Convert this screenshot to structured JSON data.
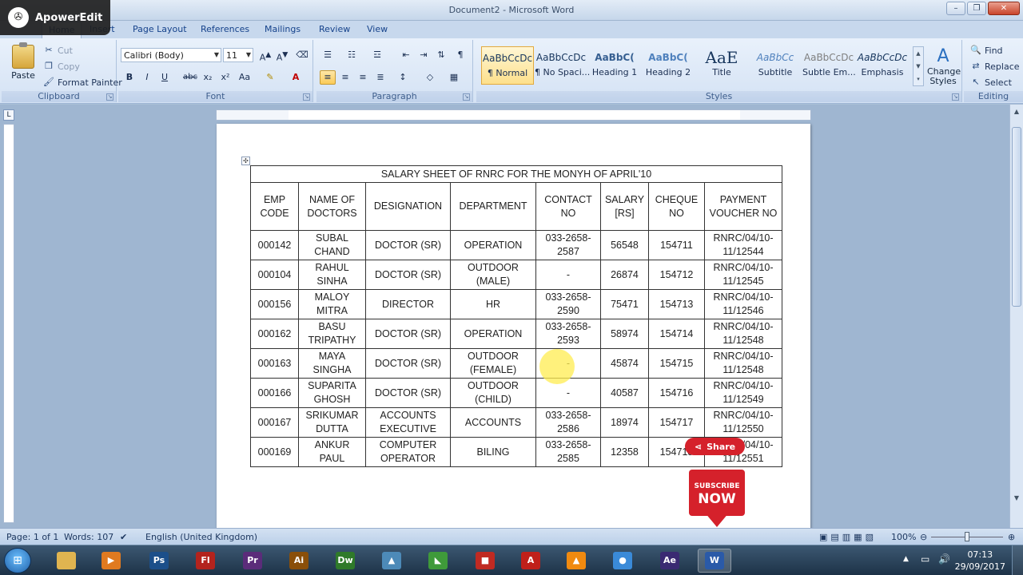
{
  "watermark": {
    "name": "ApowerEdit"
  },
  "window": {
    "title": "Document2 - Microsoft Word"
  },
  "tabs": [
    "Home",
    "Insert",
    "Page Layout",
    "References",
    "Mailings",
    "Review",
    "View"
  ],
  "clipboard": {
    "paste": "Paste",
    "cut": "Cut",
    "copy": "Copy",
    "format_painter": "Format Painter",
    "label": "Clipboard"
  },
  "font": {
    "name": "Calibri (Body)",
    "size": "11",
    "label": "Font"
  },
  "paragraph": {
    "label": "Paragraph"
  },
  "styles": {
    "label": "Styles",
    "items": [
      {
        "sample": "AaBbCcDc",
        "name": "¶ Normal"
      },
      {
        "sample": "AaBbCcDc",
        "name": "¶ No Spaci..."
      },
      {
        "sample": "AaBbC(",
        "name": "Heading 1"
      },
      {
        "sample": "AaBbC(",
        "name": "Heading 2"
      },
      {
        "sample": "AaE",
        "name": "Title"
      },
      {
        "sample": "AaBbCc",
        "name": "Subtitle"
      },
      {
        "sample": "AaBbCcDc",
        "name": "Subtle Em..."
      },
      {
        "sample": "AaBbCcDc",
        "name": "Emphasis"
      }
    ],
    "change_styles": "Change Styles"
  },
  "editing": {
    "find": "Find",
    "replace": "Replace",
    "select": "Select",
    "label": "Editing"
  },
  "table": {
    "caption": "SALARY SHEET OF RNRC FOR THE MONYH OF APRIL'10",
    "headers": [
      "EMP CODE",
      "NAME OF DOCTORS",
      "DESIGNATION",
      "DEPARTMENT",
      "CONTACT NO",
      "SALARY [RS]",
      "CHEQUE NO",
      "PAYMENT VOUCHER NO"
    ],
    "rows": [
      [
        "000142",
        "SUBAL CHAND",
        "DOCTOR (SR)",
        "OPERATION",
        "033-2658-2587",
        "56548",
        "154711",
        "RNRC/04/10-11/12544"
      ],
      [
        "000104",
        "RAHUL SINHA",
        "DOCTOR (SR)",
        "OUTDOOR (MALE)",
        "-",
        "26874",
        "154712",
        "RNRC/04/10-11/12545"
      ],
      [
        "000156",
        "MALOY MITRA",
        "DIRECTOR",
        "HR",
        "033-2658-2590",
        "75471",
        "154713",
        "RNRC/04/10-11/12546"
      ],
      [
        "000162",
        "BASU TRIPATHY",
        "DOCTOR (SR)",
        "OPERATION",
        "033-2658-2593",
        "58974",
        "154714",
        "RNRC/04/10-11/12548"
      ],
      [
        "000163",
        "MAYA SINGHA",
        "DOCTOR (SR)",
        "OUTDOOR (FEMALE)",
        "-",
        "45874",
        "154715",
        "RNRC/04/10-11/12548"
      ],
      [
        "000166",
        "SUPARITA GHOSH",
        "DOCTOR (SR)",
        "OUTDOOR (CHILD)",
        "-",
        "40587",
        "154716",
        "RNRC/04/10-11/12549"
      ],
      [
        "000167",
        "SRIKUMAR DUTTA",
        "ACCOUNTS EXECUTIVE",
        "ACCOUNTS",
        "033-2658-2586",
        "18974",
        "154717",
        "RNRC/04/10-11/12550"
      ],
      [
        "000169",
        "ANKUR PAUL",
        "COMPUTER OPERATOR",
        "BILING",
        "033-2658-2585",
        "12358",
        "154718",
        "RNRC/04/10-11/12551"
      ]
    ]
  },
  "overlays": {
    "share": "Share",
    "subscribe_top": "SUBSCRIBE",
    "subscribe_bottom": "NOW"
  },
  "status": {
    "page": "Page: 1 of 1",
    "words": "Words: 107",
    "language": "English (United Kingdom)",
    "zoom": "100%"
  },
  "taskbar": {
    "apps": [
      {
        "name": "explorer",
        "glyph": "",
        "color": "#e0b450"
      },
      {
        "name": "media-player",
        "glyph": "▶",
        "color": "#e07a20"
      },
      {
        "name": "photoshop",
        "glyph": "Ps",
        "color": "#1c4f8a"
      },
      {
        "name": "flash",
        "glyph": "Fl",
        "color": "#b3231d"
      },
      {
        "name": "premiere",
        "glyph": "Pr",
        "color": "#5b2c7a"
      },
      {
        "name": "illustrator",
        "glyph": "Ai",
        "color": "#8a4f0a"
      },
      {
        "name": "dreamweaver",
        "glyph": "Dw",
        "color": "#2f7a2a"
      },
      {
        "name": "photo-viewer",
        "glyph": "▲",
        "color": "#4d8ab8"
      },
      {
        "name": "spreadsheet",
        "glyph": "◣",
        "color": "#3f9a3a"
      },
      {
        "name": "red-box",
        "glyph": "■",
        "color": "#c02a22"
      },
      {
        "name": "acrobat",
        "glyph": "A",
        "color": "#c0201a"
      },
      {
        "name": "vlc",
        "glyph": "▲",
        "color": "#f08a10"
      },
      {
        "name": "chrome",
        "glyph": "●",
        "color": "#3a8ad8"
      },
      {
        "name": "after-effects",
        "glyph": "Ae",
        "color": "#3a2a72"
      },
      {
        "name": "word",
        "glyph": "W",
        "color": "#2a5aa8"
      }
    ],
    "time": "07:13",
    "date": "29/09/2017"
  }
}
